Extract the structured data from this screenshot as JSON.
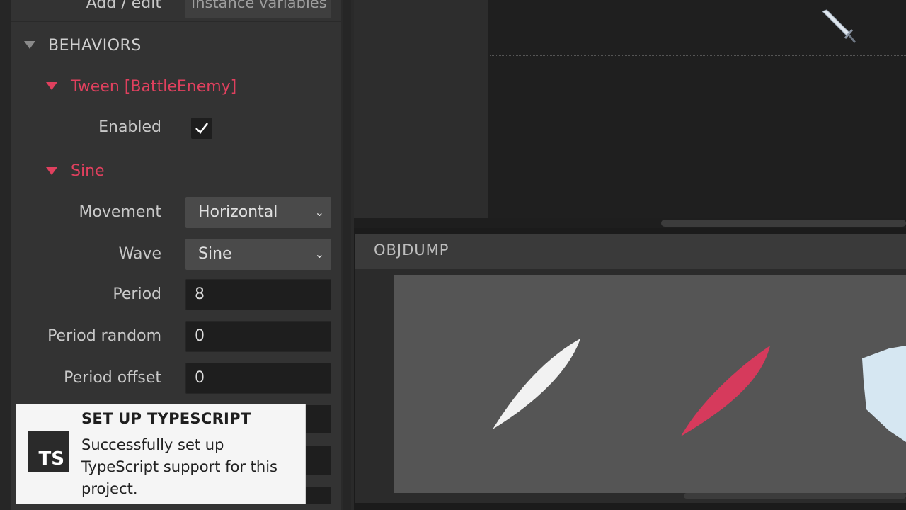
{
  "properties": {
    "add_edit_label": "Add / edit",
    "instance_variables_link": "Instance variables",
    "behaviors_section": "BEHAVIORS",
    "tween_title": "Tween [BattleEnemy]",
    "enabled_label": "Enabled",
    "enabled_checked": true,
    "sine_title": "Sine",
    "movement_label": "Movement",
    "movement_value": "Horizontal",
    "wave_label": "Wave",
    "wave_value": "Sine",
    "period_label": "Period",
    "period_value": "8",
    "period_random_label": "Period random",
    "period_random_value": "0",
    "period_offset_label": "Period offset",
    "period_offset_value": "0"
  },
  "viewport": {
    "icon": "sword-icon"
  },
  "pane": {
    "title": "OBJDUMP"
  },
  "toast": {
    "title": "SET UP TYPESCRIPT",
    "message": "Successfully set up TypeScript support for this project.",
    "badge": "TS"
  },
  "colors": {
    "accent_red": "#e0405e",
    "panel": "#333333",
    "field": "#1e1e1e"
  }
}
